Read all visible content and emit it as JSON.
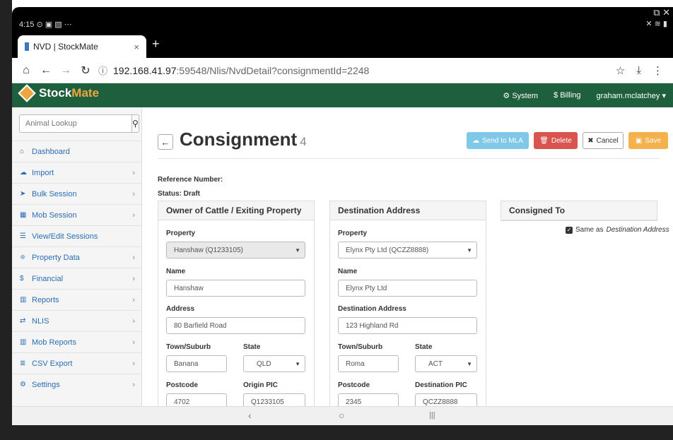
{
  "status": {
    "time": "4:15",
    "left_icons": "⊙ ▣ ▧ ⋯",
    "right_icons": "✕ ≋ ▮",
    "corner_icons": "⧉ ✕"
  },
  "browser": {
    "tab_title": "NVD | StockMate",
    "tab_close": "×",
    "new_tab": "+",
    "url_host": "192.168.41.97",
    "url_path": ":59548/Nlis/NvdDetail?consignmentId=2248"
  },
  "navbar": {
    "brand_prefix": "Stock",
    "brand_suffix": "Mate",
    "items": [
      "System",
      "Billing",
      "graham.mclatchey ▾"
    ]
  },
  "sidebar": {
    "lookup_placeholder": "Animal Lookup",
    "items": [
      {
        "label": "Dashboard",
        "icon": "home-icon",
        "glyph": "⌂",
        "chevron": false
      },
      {
        "label": "Import",
        "icon": "cloud-upload-icon",
        "glyph": "☁",
        "chevron": true
      },
      {
        "label": "Bulk Session",
        "icon": "send-icon",
        "glyph": "➤",
        "chevron": true
      },
      {
        "label": "Mob Session",
        "icon": "grid-icon",
        "glyph": "▦",
        "chevron": true
      },
      {
        "label": "View/Edit Sessions",
        "icon": "list-icon",
        "glyph": "☰",
        "chevron": false
      },
      {
        "label": "Property Data",
        "icon": "sliders-icon",
        "glyph": "≑",
        "chevron": true
      },
      {
        "label": "Financial",
        "icon": "dollar-icon",
        "glyph": "$",
        "chevron": true
      },
      {
        "label": "Reports",
        "icon": "bar-chart-icon",
        "glyph": "▥",
        "chevron": true
      },
      {
        "label": "NLIS",
        "icon": "exchange-icon",
        "glyph": "⇄",
        "chevron": true
      },
      {
        "label": "Mob Reports",
        "icon": "bar-chart-icon",
        "glyph": "▥",
        "chevron": true
      },
      {
        "label": "CSV Export",
        "icon": "database-icon",
        "glyph": "≣",
        "chevron": true
      },
      {
        "label": "Settings",
        "icon": "cogs-icon",
        "glyph": "⚙",
        "chevron": true
      }
    ]
  },
  "main": {
    "title": "Consignment",
    "count": "4",
    "buttons": {
      "send": "Send to MLA",
      "delete": "Delete",
      "cancel": "Cancel",
      "save": "Save"
    },
    "reference_label": "Reference Number:",
    "status_label": "Status: Draft",
    "owner": {
      "heading": "Owner of Cattle / Exiting Property",
      "property_label": "Property",
      "property_value": "Hanshaw (Q1233105)",
      "name_label": "Name",
      "name_value": "Hanshaw",
      "address_label": "Address",
      "address_value": "80 Barfield Road",
      "town_label": "Town/Suburb",
      "town_value": "Banana",
      "state_label": "State",
      "state_value": "QLD",
      "postcode_label": "Postcode",
      "postcode_value": "4702",
      "pic_label": "Origin PIC",
      "pic_value": "Q1233105"
    },
    "destination": {
      "heading": "Destination Address",
      "property_label": "Property",
      "property_value": "Elynx Pty Ltd (QCZZ8888)",
      "name_label": "Name",
      "name_value": "Elynx Pty Ltd",
      "address_label": "Destination Address",
      "address_value": "123 Highland Rd",
      "town_label": "Town/Suburb",
      "town_value": "Roma",
      "state_label": "State",
      "state_value": "ACT",
      "postcode_label": "Postcode",
      "postcode_value": "2345",
      "pic_label": "Destination PIC",
      "pic_value": "QCZZ8888"
    },
    "consigned": {
      "heading": "Consigned To",
      "same_as_prefix": "Same as",
      "same_as_target": "Destination Address"
    }
  },
  "android_nav": {
    "back": "‹",
    "home": "○",
    "recents": "|||"
  }
}
